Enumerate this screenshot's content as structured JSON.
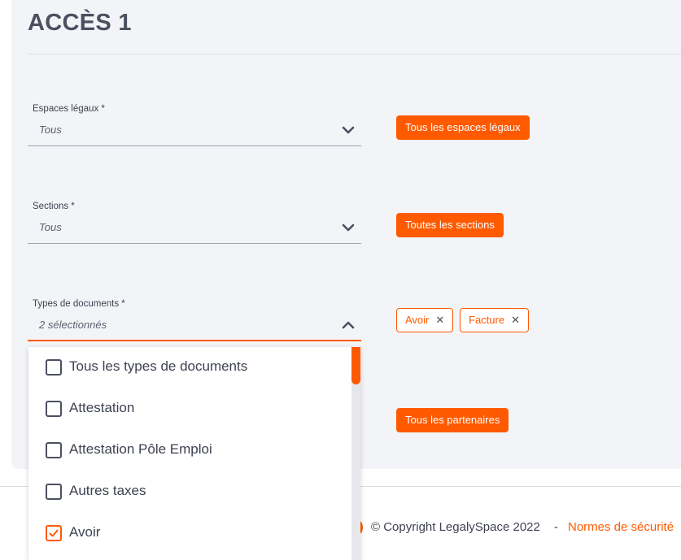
{
  "page": {
    "title": "ACCÈS 1"
  },
  "fields": {
    "espaces": {
      "label": "Espaces légaux *",
      "value": "Tous",
      "pill": "Tous les espaces légaux"
    },
    "sections": {
      "label": "Sections *",
      "value": "Tous",
      "pill": "Toutes les sections"
    },
    "types": {
      "label": "Types de documents *",
      "value": "2 sélectionnés",
      "tags": [
        {
          "label": "Avoir"
        },
        {
          "label": "Facture"
        }
      ]
    },
    "partenaires": {
      "pill": "Tous les partenaires"
    }
  },
  "dropdown": {
    "options": [
      {
        "label": "Tous les types de documents",
        "checked": false
      },
      {
        "label": "Attestation",
        "checked": false
      },
      {
        "label": "Attestation Pôle Emploi",
        "checked": false
      },
      {
        "label": "Autres taxes",
        "checked": false
      },
      {
        "label": "Avoir",
        "checked": true
      }
    ]
  },
  "footer": {
    "copyright": "© Copyright LegalySpace 2022",
    "separator": "-",
    "link": "Normes de sécurité"
  },
  "colors": {
    "accent": "#ff5a00",
    "text": "#3d4250",
    "panel": "#f3f4f7"
  }
}
